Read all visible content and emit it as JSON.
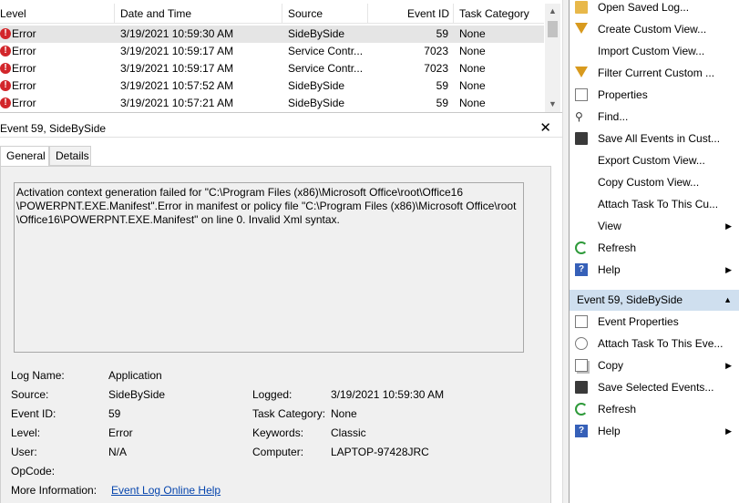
{
  "list": {
    "columns": [
      "Level",
      "Date and Time",
      "Source",
      "Event ID",
      "Task Category"
    ],
    "rows": [
      {
        "level": "Error",
        "datetime": "3/19/2021 10:59:30 AM",
        "source": "SideBySide",
        "event_id": "59",
        "category": "None"
      },
      {
        "level": "Error",
        "datetime": "3/19/2021 10:59:17 AM",
        "source": "Service Contr...",
        "event_id": "7023",
        "category": "None"
      },
      {
        "level": "Error",
        "datetime": "3/19/2021 10:59:17 AM",
        "source": "Service Contr...",
        "event_id": "7023",
        "category": "None"
      },
      {
        "level": "Error",
        "datetime": "3/19/2021 10:57:52 AM",
        "source": "SideBySide",
        "event_id": "59",
        "category": "None"
      },
      {
        "level": "Error",
        "datetime": "3/19/2021 10:57:21 AM",
        "source": "SideBySide",
        "event_id": "59",
        "category": "None"
      }
    ],
    "error_glyph": "!"
  },
  "detail": {
    "title": "Event 59, SideBySide",
    "close_glyph": "✕",
    "tabs": [
      "General",
      "Details"
    ],
    "message": "Activation context generation failed for \"C:\\Program Files (x86)\\Microsoft Office\\root\\Office16\n\\POWERPNT.EXE.Manifest\".Error in manifest or policy file \"C:\\Program Files (x86)\\Microsoft Office\\root\n\\Office16\\POWERPNT.EXE.Manifest\" on line 0. Invalid Xml syntax.",
    "labels": {
      "log_name": "Log Name:",
      "source": "Source:",
      "event_id": "Event ID:",
      "level": "Level:",
      "user": "User:",
      "opcode": "OpCode:",
      "more_info": "More Information:",
      "logged": "Logged:",
      "task_category": "Task Category:",
      "keywords": "Keywords:",
      "computer": "Computer:"
    },
    "values": {
      "log_name": "Application",
      "source": "SideBySide",
      "event_id": "59",
      "level": "Error",
      "user": "N/A",
      "opcode": "",
      "more_info_link": "Event Log Online Help",
      "logged": "3/19/2021 10:59:30 AM",
      "task_category": "None",
      "keywords": "Classic",
      "computer": "LAPTOP-97428JRC"
    }
  },
  "actions": {
    "log_items": [
      {
        "label": "Open Saved Log...",
        "icon": "folder-icon"
      },
      {
        "label": "Create Custom View...",
        "icon": "filter-icon"
      },
      {
        "label": "Import Custom View...",
        "icon": ""
      },
      {
        "label": "Filter Current Custom ...",
        "icon": "filter-icon"
      },
      {
        "label": "Properties",
        "icon": "document-icon"
      },
      {
        "label": "Find...",
        "icon": "binoculars-icon"
      },
      {
        "label": "Save All Events in Cust...",
        "icon": "save-icon"
      },
      {
        "label": "Export Custom View...",
        "icon": ""
      },
      {
        "label": "Copy Custom View...",
        "icon": ""
      },
      {
        "label": "Attach Task To This Cu...",
        "icon": ""
      },
      {
        "label": "View",
        "icon": "",
        "submenu": true
      },
      {
        "label": "Refresh",
        "icon": "refresh-icon"
      },
      {
        "label": "Help",
        "icon": "help-icon",
        "submenu": true
      }
    ],
    "event_header": "Event 59, SideBySide",
    "event_items": [
      {
        "label": "Event Properties",
        "icon": "document-icon"
      },
      {
        "label": "Attach Task To This Eve...",
        "icon": "clock-icon"
      },
      {
        "label": "Copy",
        "icon": "copy-icon",
        "submenu": true
      },
      {
        "label": "Save Selected Events...",
        "icon": "save-icon"
      },
      {
        "label": "Refresh",
        "icon": "refresh-icon"
      },
      {
        "label": "Help",
        "icon": "help-icon",
        "submenu": true
      }
    ],
    "submenu_glyph": "▶",
    "collapse_glyph": "▲"
  },
  "help_glyph": "?",
  "find_glyph": "⚲"
}
